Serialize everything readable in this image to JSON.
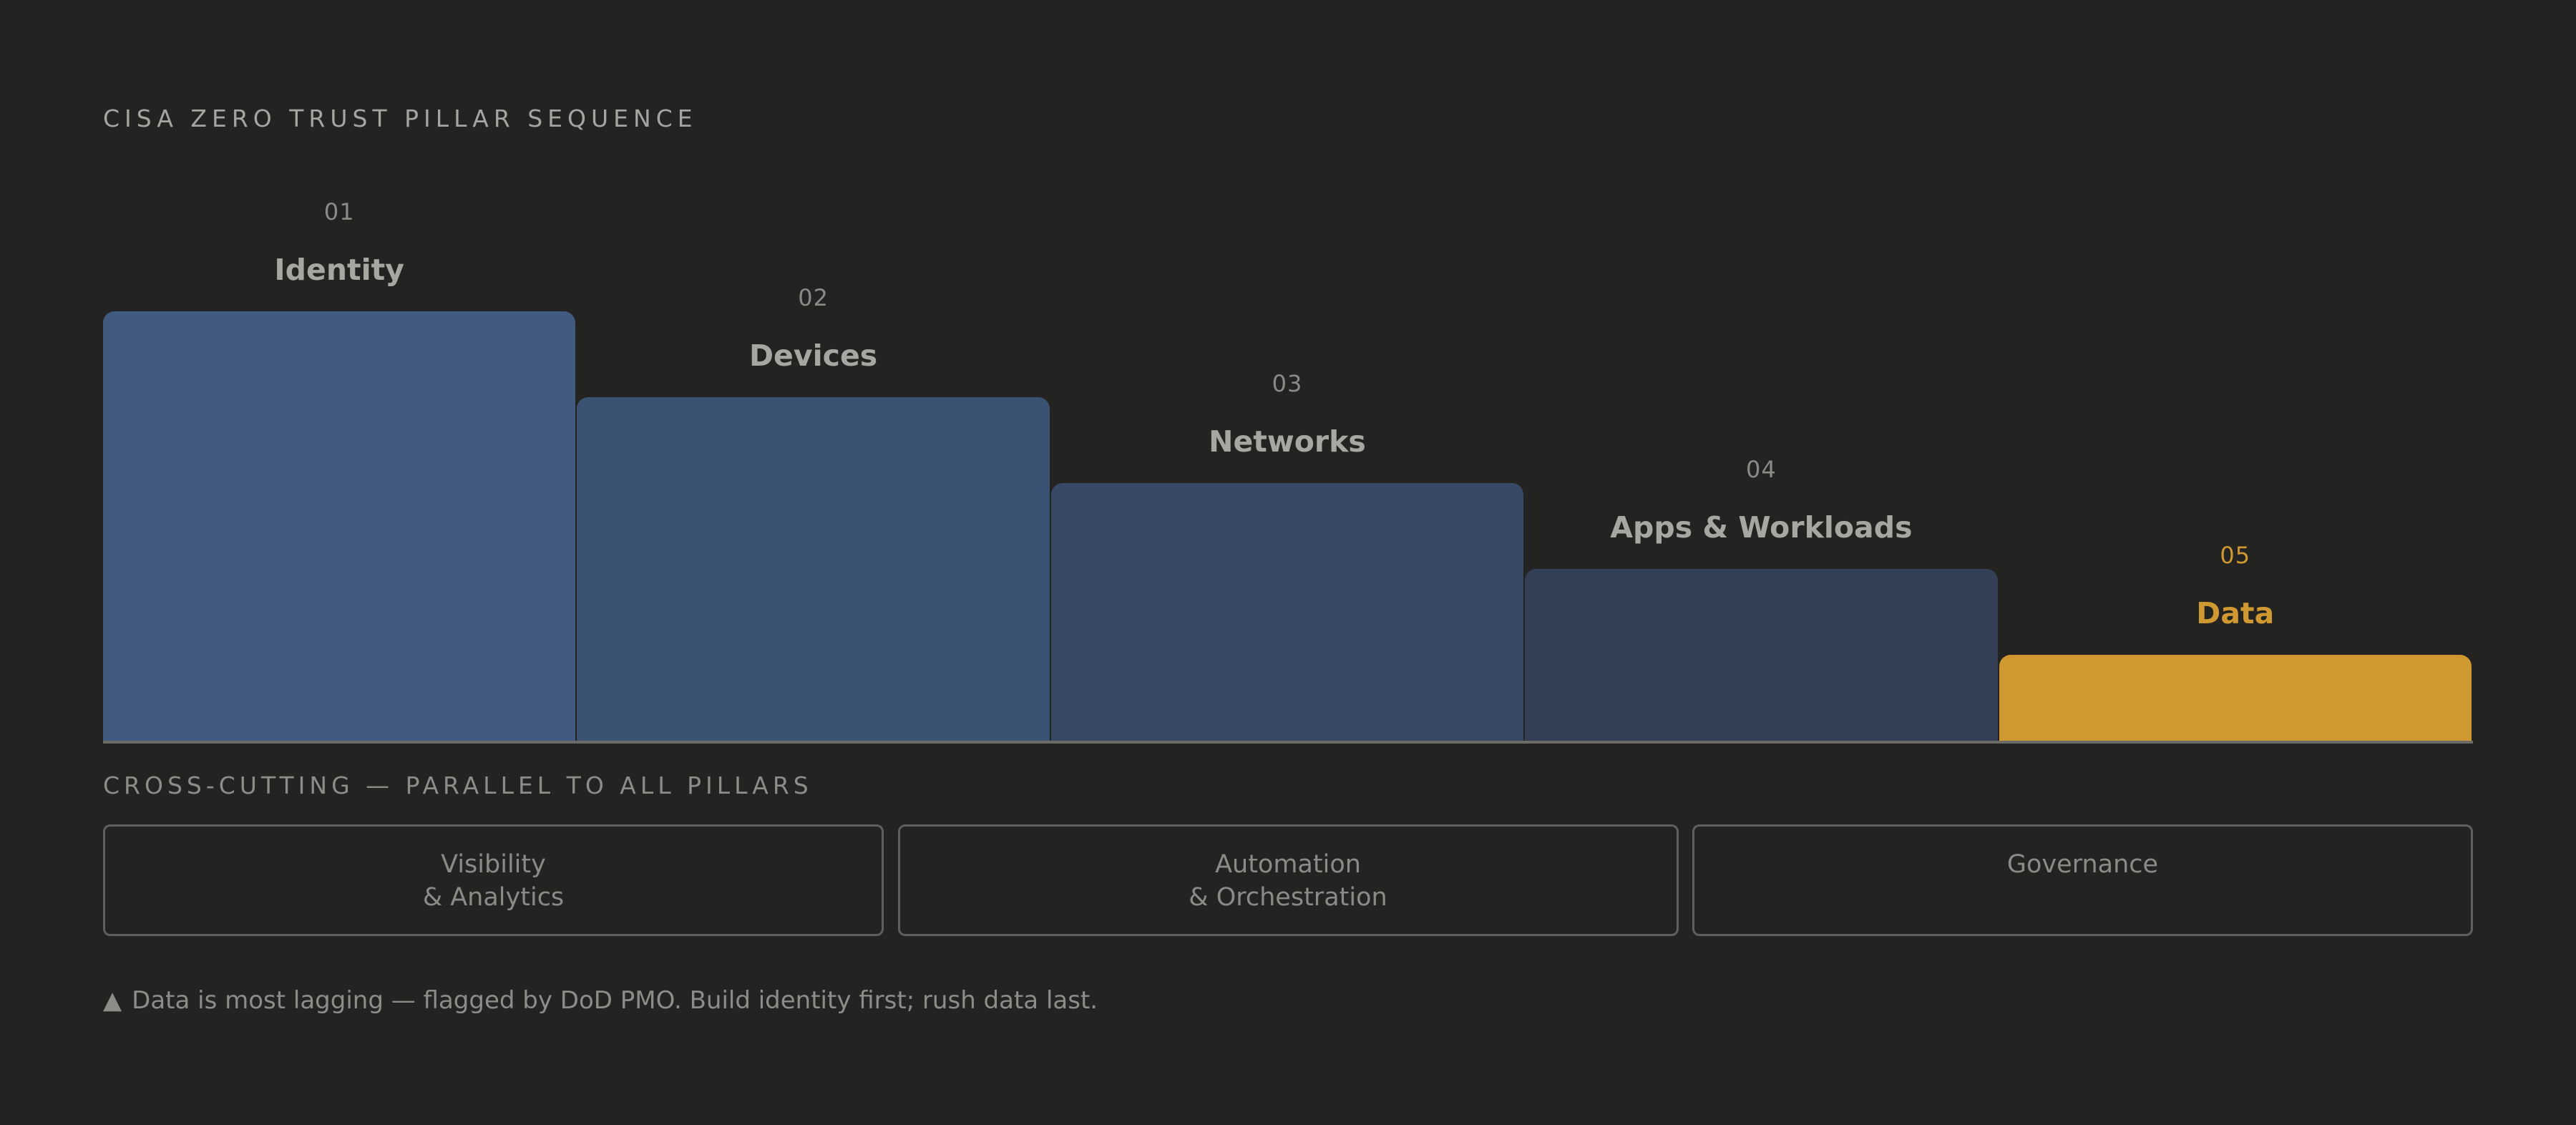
{
  "title": "CISA ZERO TRUST PILLAR SEQUENCE",
  "pillars": [
    {
      "num": "01",
      "label": "Identity",
      "color": "#435a80"
    },
    {
      "num": "02",
      "label": "Devices",
      "color": "#3c5273"
    },
    {
      "num": "03",
      "label": "Networks",
      "color": "#374965"
    },
    {
      "num": "04",
      "label": "Apps & Workloads",
      "color": "#323f55"
    },
    {
      "num": "05",
      "label": "Data",
      "color": "#d09830",
      "highlight": true
    }
  ],
  "cross_cutting": {
    "label": "CROSS-CUTTING — PARALLEL TO ALL PILLARS",
    "items": [
      {
        "line1": "Visibility",
        "line2": "& Analytics"
      },
      {
        "line1": "Automation",
        "line2": "& Orchestration"
      },
      {
        "line1": "Governance",
        "line2": ""
      }
    ]
  },
  "note": {
    "icon": "▲",
    "text": "Data is most lagging — flagged by DoD PMO. Build identity first; rush data last."
  },
  "colors": {
    "background": "#232321",
    "highlight_text": "#d09830"
  }
}
